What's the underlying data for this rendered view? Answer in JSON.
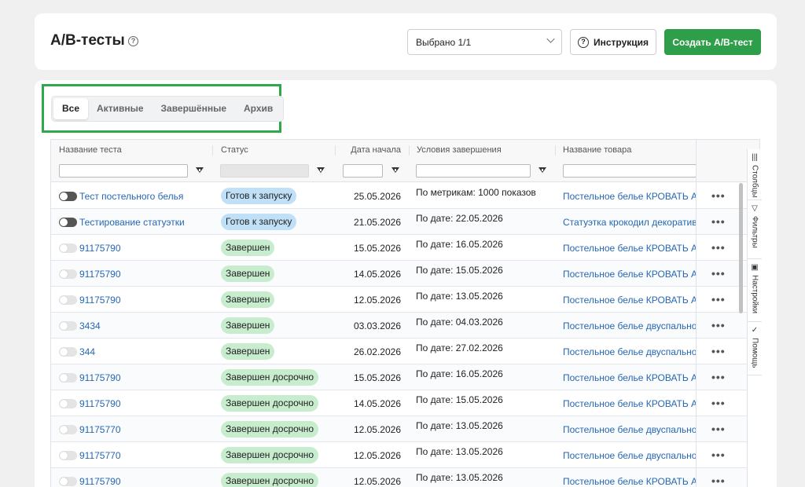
{
  "header": {
    "title": "А/В-тесты",
    "help_icon": "?",
    "select_value": "Выбрано 1/1",
    "instruction_label": "Инструкция",
    "create_label": "Создать А/В-тест"
  },
  "colors": {
    "accent": "#2f9e4a",
    "link": "#2667b3",
    "ready_badge": "#bfe0f7",
    "done_badge": "#c7ecce"
  },
  "tabs": [
    {
      "label": "Все",
      "active": true
    },
    {
      "label": "Активные"
    },
    {
      "label": "Завершённые"
    },
    {
      "label": "Архив"
    }
  ],
  "columns": {
    "name": "Название теста",
    "status": "Статус",
    "start": "Дата начала",
    "cond": "Условия завершения",
    "product": "Название товара"
  },
  "rows": [
    {
      "toggle": "on",
      "name": "Тест постельного белья",
      "status": "Готов к запуску",
      "kind": "ready",
      "date": "25.05.2026",
      "cond": "По метрикам: 1000 показов",
      "product": "Постельное белье КРОВАТЬ АА"
    },
    {
      "toggle": "on",
      "name": "Тестирование статуэтки",
      "status": "Готов к запуску",
      "kind": "ready",
      "date": "21.05.2026",
      "cond": "По дате: 22.05.2026",
      "product": "Статуэтка крокодил декоратив"
    },
    {
      "toggle": "off",
      "name": "91175790",
      "status": "Завершен",
      "kind": "done",
      "date": "15.05.2026",
      "cond": "По дате: 16.05.2026",
      "product": "Постельное белье КРОВАТЬ АА"
    },
    {
      "toggle": "off",
      "name": "91175790",
      "status": "Завершен",
      "kind": "done",
      "date": "14.05.2026",
      "cond": "По дате: 15.05.2026",
      "product": "Постельное белье КРОВАТЬ АА"
    },
    {
      "toggle": "off",
      "name": "91175790",
      "status": "Завершен",
      "kind": "done",
      "date": "12.05.2026",
      "cond": "По дате: 13.05.2026",
      "product": "Постельное белье КРОВАТЬ АА"
    },
    {
      "toggle": "off",
      "name": "3434",
      "status": "Завершен",
      "kind": "done",
      "date": "03.03.2026",
      "cond": "По дате: 04.03.2026",
      "product": "Постельное белье двуспальное"
    },
    {
      "toggle": "off",
      "name": "344",
      "status": "Завершен",
      "kind": "done",
      "date": "26.02.2026",
      "cond": "По дате: 27.02.2026",
      "product": "Постельное белье двуспальное"
    },
    {
      "toggle": "off",
      "name": "91175790",
      "status": "Завершен досрочно",
      "kind": "done",
      "date": "15.05.2026",
      "cond": "По дате: 16.05.2026",
      "product": "Постельное белье КРОВАТЬ АА"
    },
    {
      "toggle": "off",
      "name": "91175790",
      "status": "Завершен досрочно",
      "kind": "done",
      "date": "14.05.2026",
      "cond": "По дате: 15.05.2026",
      "product": "Постельное белье КРОВАТЬ АА"
    },
    {
      "toggle": "off",
      "name": "91175770",
      "status": "Завершен досрочно",
      "kind": "done",
      "date": "12.05.2026",
      "cond": "По дате: 13.05.2026",
      "product": "Постельное белье двуспальное"
    },
    {
      "toggle": "off",
      "name": "91175770",
      "status": "Завершен досрочно",
      "kind": "done",
      "date": "12.05.2026",
      "cond": "По дате: 13.05.2026",
      "product": "Постельное белье двуспальное"
    },
    {
      "toggle": "off",
      "name": "91175790",
      "status": "Завершен досрочно",
      "kind": "done",
      "date": "12.05.2026",
      "cond": "По дате: 13.05.2026",
      "product": "Постельное белье КРОВАТЬ АА"
    }
  ],
  "row_menu": "•••",
  "side_panel": [
    {
      "label": "Столбцы",
      "icon": "columns-icon",
      "glyph": "|||"
    },
    {
      "label": "Фильтры",
      "icon": "filter-icon",
      "glyph": "▽"
    },
    {
      "label": "Настройки",
      "icon": "settings-icon",
      "glyph": "▣"
    },
    {
      "label": "Помощь",
      "icon": "check-icon",
      "glyph": "✓"
    }
  ]
}
